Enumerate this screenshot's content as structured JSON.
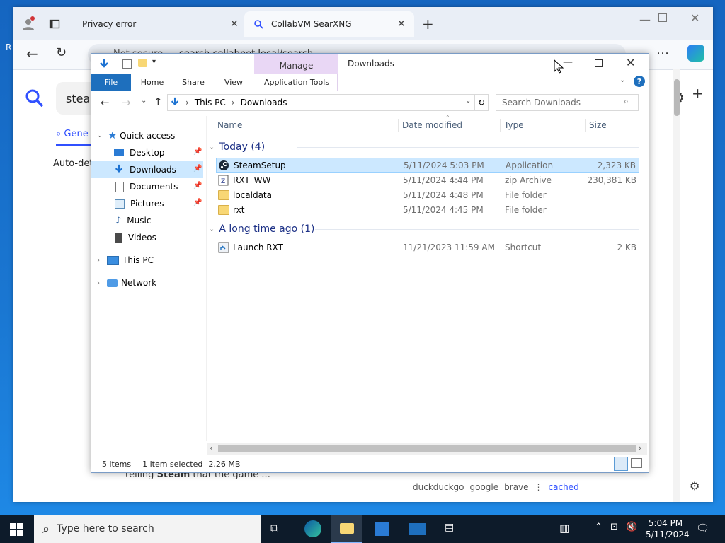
{
  "colors": {
    "accent": "#0063b1",
    "manage_tab": "#e9d7f5",
    "selection": "#cce8ff"
  },
  "browser": {
    "tabs": [
      {
        "label": "Privacy error",
        "icon": "warning-icon"
      },
      {
        "label": "CollabVM SearXNG",
        "icon": "searxng-icon"
      }
    ],
    "address": {
      "prefix": "Not secure",
      "url": "search.collabnet.local/search"
    },
    "page": {
      "query_prefix": "stear",
      "tab_general": "Gene",
      "auto_detect": "Auto-dete",
      "snippet_prefix": "telling ",
      "snippet_bold": "Steam",
      "snippet_suffix": " that the game ...",
      "engines": [
        "duckduckgo",
        "google",
        "brave"
      ],
      "cached": "cached"
    }
  },
  "explorer": {
    "ribbon": {
      "manage": "Manage",
      "title": "Downloads",
      "tabs": [
        "File",
        "Home",
        "Share",
        "View",
        "Application Tools"
      ]
    },
    "nav": {
      "breadcrumb": [
        "This PC",
        "Downloads"
      ],
      "search_placeholder": "Search Downloads"
    },
    "sidebar": {
      "quick_access": "Quick access",
      "items": [
        "Desktop",
        "Downloads",
        "Documents",
        "Pictures",
        "Music",
        "Videos"
      ],
      "this_pc": "This PC",
      "network": "Network"
    },
    "columns": [
      "Name",
      "Date modified",
      "Type",
      "Size"
    ],
    "groups": [
      {
        "label": "Today (4)",
        "files": [
          {
            "name": "SteamSetup",
            "date": "5/11/2024 5:03 PM",
            "type": "Application",
            "size": "2,323 KB",
            "icon": "steam-icon"
          },
          {
            "name": "RXT_WW",
            "date": "5/11/2024 4:44 PM",
            "type": "zip Archive",
            "size": "230,381 KB",
            "icon": "zip-icon"
          },
          {
            "name": "localdata",
            "date": "5/11/2024 4:48 PM",
            "type": "File folder",
            "size": "",
            "icon": "folder-icon"
          },
          {
            "name": "rxt",
            "date": "5/11/2024 4:45 PM",
            "type": "File folder",
            "size": "",
            "icon": "folder-icon"
          }
        ]
      },
      {
        "label": "A long time ago (1)",
        "files": [
          {
            "name": "Launch RXT",
            "date": "11/21/2023 11:59 AM",
            "type": "Shortcut",
            "size": "2 KB",
            "icon": "shortcut-icon"
          }
        ]
      }
    ],
    "status": {
      "items": "5 items",
      "selected": "1 item selected",
      "size": "2.26 MB"
    }
  },
  "taskbar": {
    "search_placeholder": "Type here to search",
    "time": "5:04 PM",
    "date": "5/11/2024"
  }
}
